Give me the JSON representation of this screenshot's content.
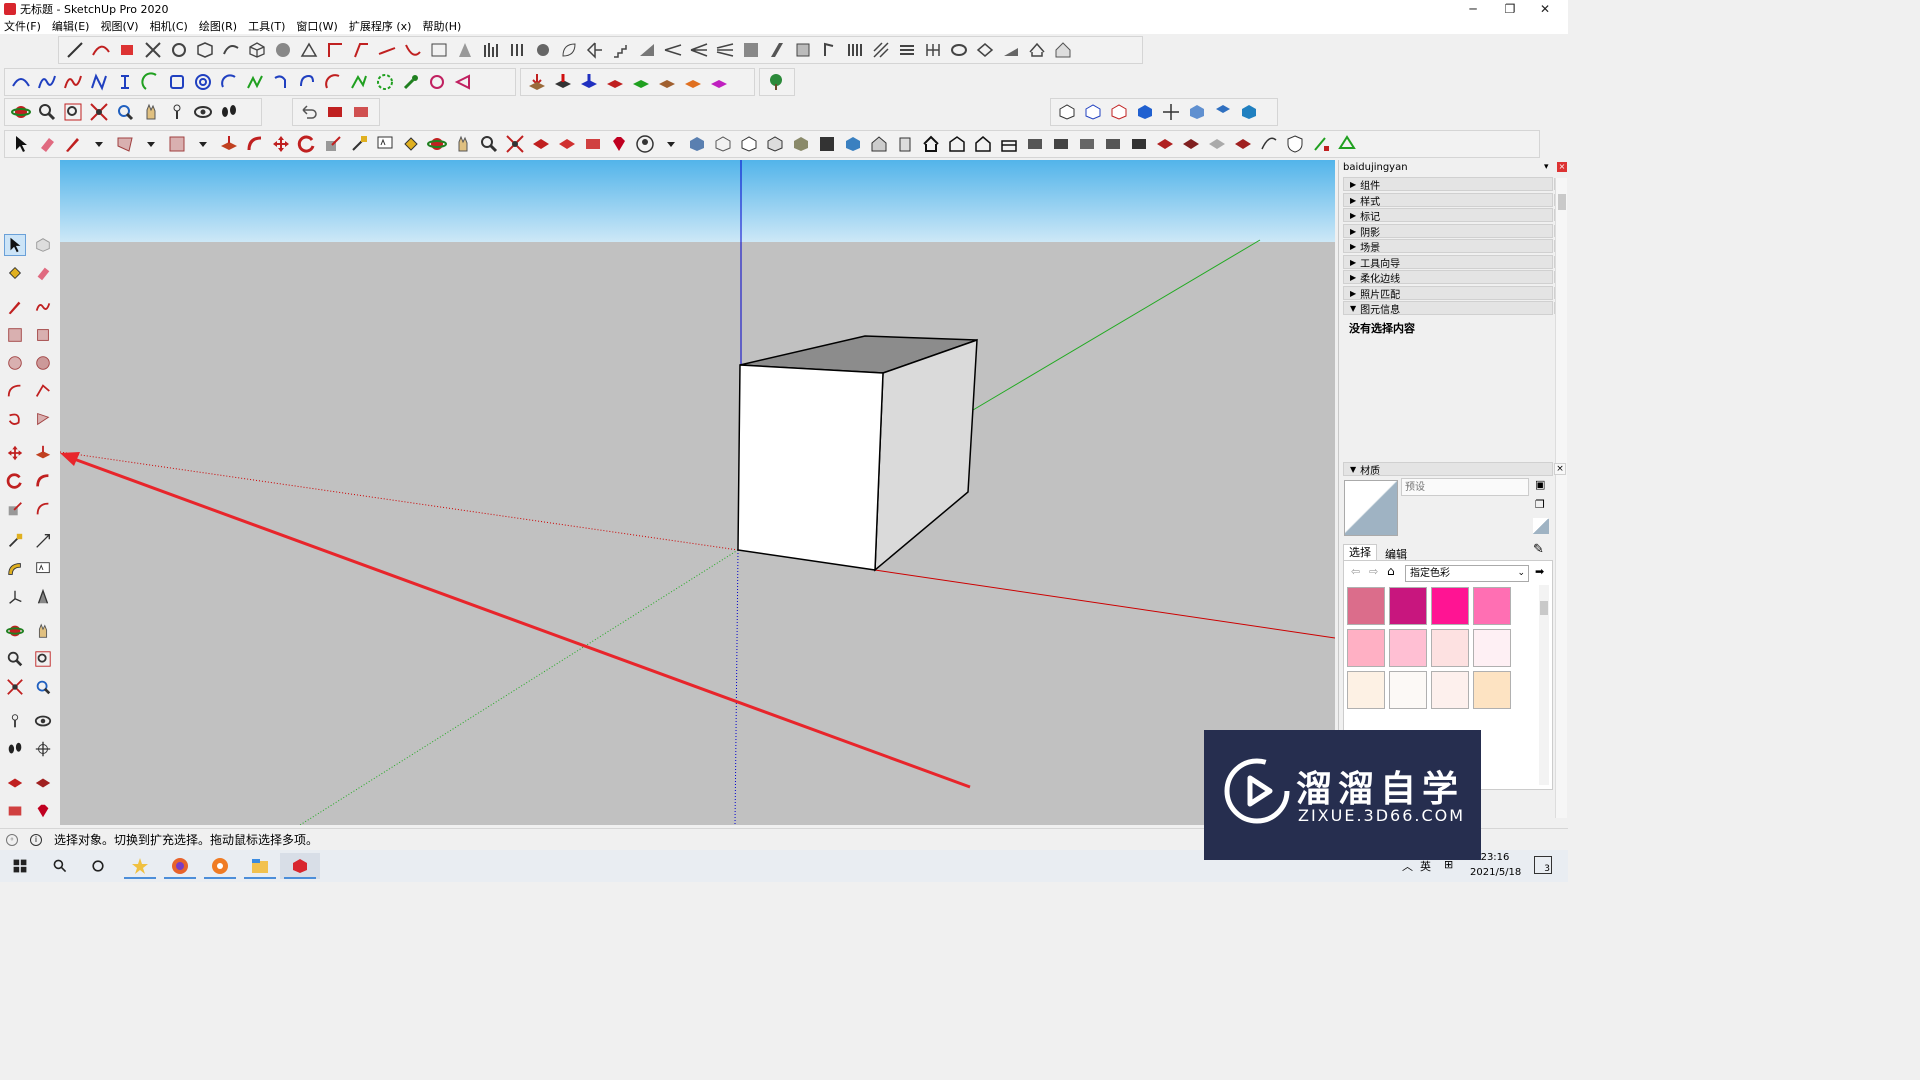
{
  "window": {
    "title": "无标题 - SketchUp Pro 2020",
    "minimize_glyph": "─",
    "restore_glyph": "❐",
    "close_glyph": "✕"
  },
  "menu": [
    "文件(F)",
    "编辑(E)",
    "视图(V)",
    "相机(C)",
    "绘图(R)",
    "工具(T)",
    "窗口(W)",
    "扩展程序 (x)",
    "帮助(H)"
  ],
  "tray": {
    "title": "baidujingyan",
    "panels": [
      "组件",
      "样式",
      "标记",
      "阴影",
      "场景",
      "工具向导",
      "柔化边线",
      "照片匹配",
      "图元信息"
    ],
    "entity_info_text": "没有选择内容",
    "materials": {
      "header": "材质",
      "name_placeholder": "预设",
      "tab_select": "选择",
      "tab_edit": "编辑",
      "collection": "指定色彩",
      "swatch_colors": [
        "#db6d8b",
        "#c8167e",
        "#ff1493",
        "#ff6fb3",
        "#ffb0c4",
        "#ffbfd3",
        "#fde1e1",
        "#fef0f4",
        "#fdf1e4",
        "#fcf9f6",
        "#fdf0ed",
        "#fde3c2"
      ]
    }
  },
  "status": {
    "text": "选择对象。切换到扩充选择。拖动鼠标选择多项。"
  },
  "taskbar": {
    "ime_label": "英",
    "time": "23:16",
    "date": "2021/5/18",
    "notification_count": "3"
  },
  "watermark": {
    "title": "溜溜自学",
    "subtitle": "ZIXUE.3D66.COM"
  },
  "colors": {
    "sky_top": "#52b4ea",
    "ground": "#c1c1c1",
    "red_axis": "#cc0000",
    "green_axis": "#22aa22",
    "blue_axis": "#0000cc",
    "annotation_arrow": "#e8252b"
  }
}
